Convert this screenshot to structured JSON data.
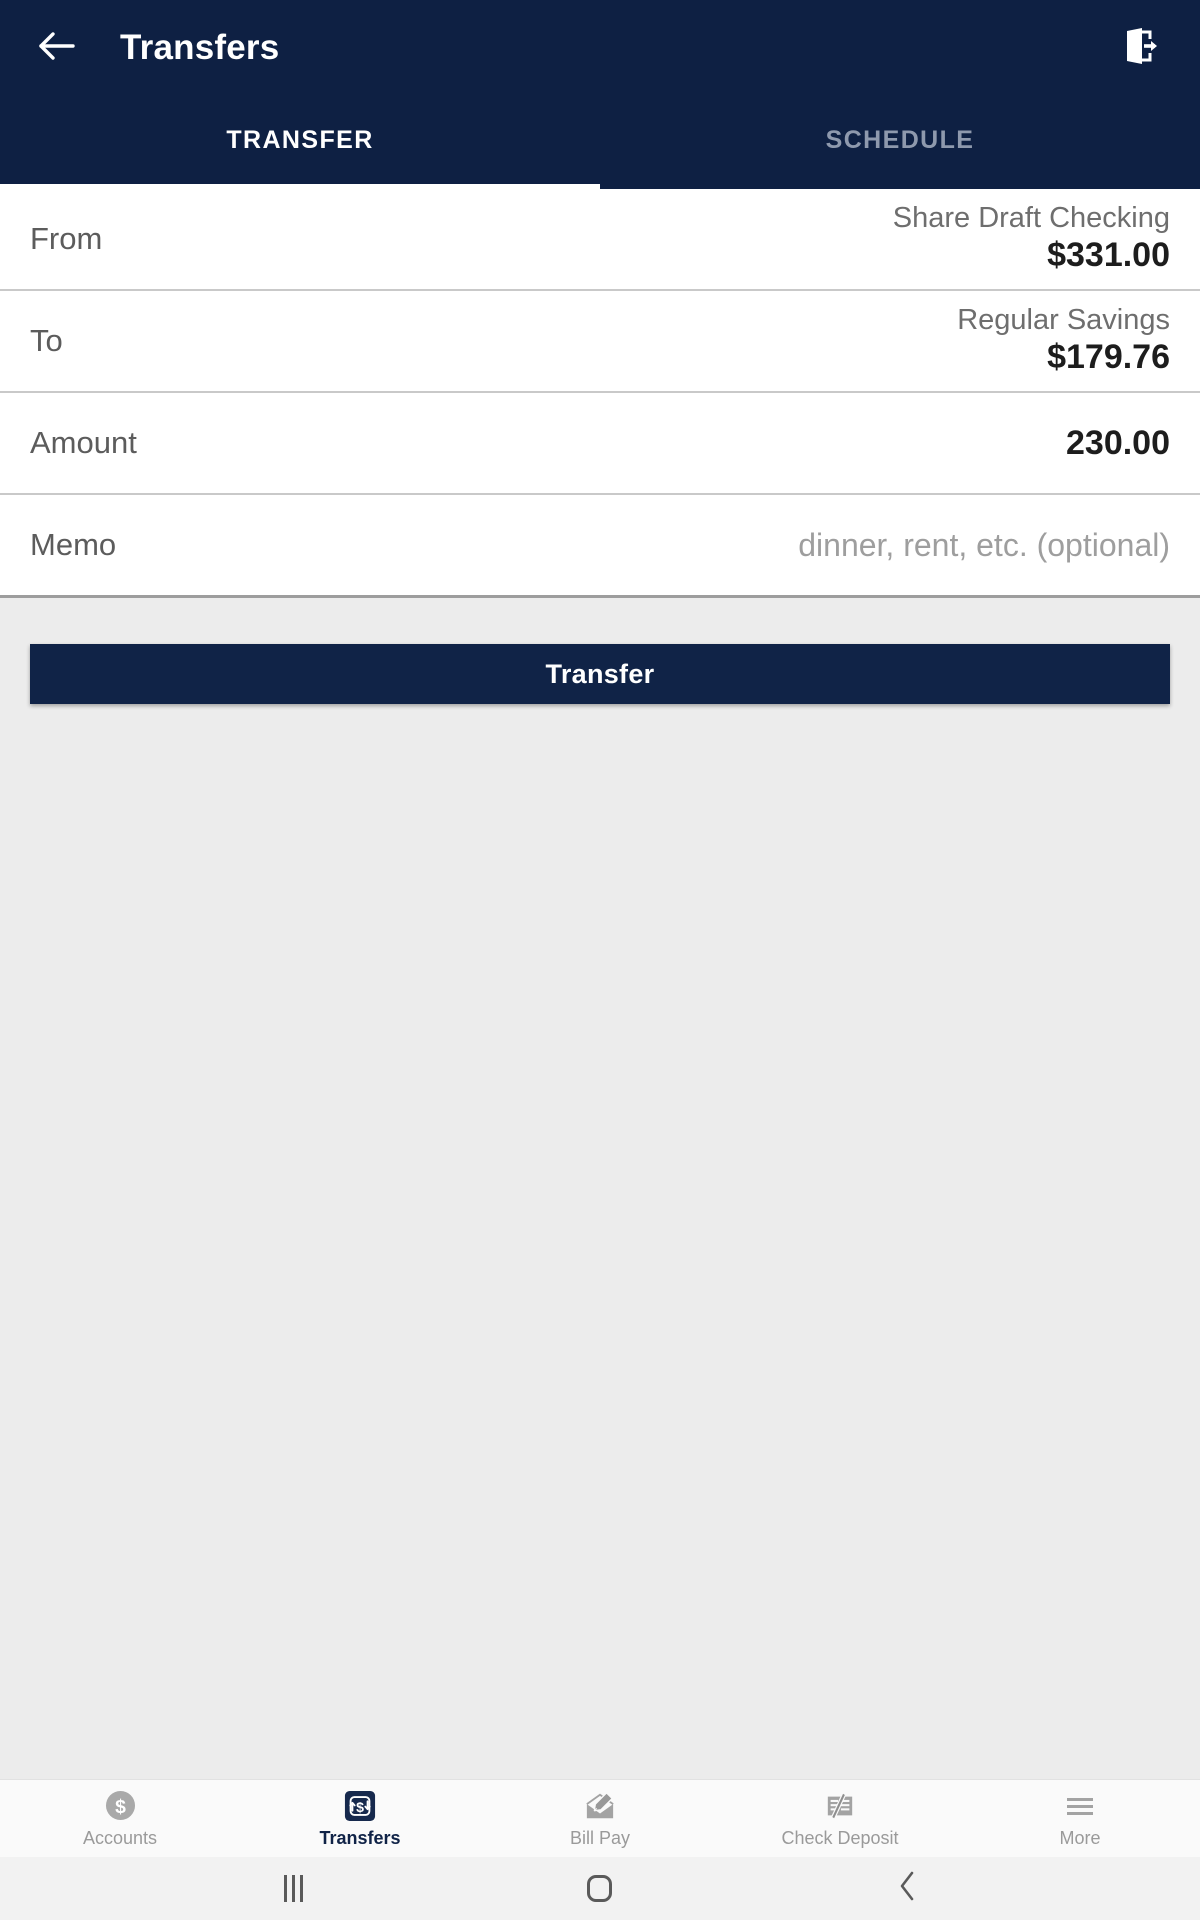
{
  "theme": {
    "brand_navy": "#0e2043",
    "button_navy": "#102347",
    "body_gray": "#ececec",
    "divider_gray": "#c9c9c9",
    "muted_text": "#9a9a9a"
  },
  "appbar": {
    "title": "Transfers",
    "back_icon": "arrow-left-icon",
    "logout_icon": "logout-icon"
  },
  "tabs": [
    {
      "label": "TRANSFER",
      "active": true
    },
    {
      "label": "SCHEDULE",
      "active": false
    }
  ],
  "form": {
    "rows": [
      {
        "label": "From",
        "account_name": "Share Draft Checking",
        "balance": "$331.00"
      },
      {
        "label": "To",
        "account_name": "Regular Savings",
        "balance": "$179.76"
      },
      {
        "label": "Amount",
        "value": "230.00"
      },
      {
        "label": "Memo",
        "placeholder": "dinner, rent, etc. (optional)",
        "value": ""
      }
    ]
  },
  "actions": {
    "transfer_label": "Transfer"
  },
  "bottom_nav": [
    {
      "label": "Accounts",
      "icon": "dollar-circle-icon",
      "active": false
    },
    {
      "label": "Transfers",
      "icon": "transfer-arrows-icon",
      "active": true
    },
    {
      "label": "Bill Pay",
      "icon": "envelope-pen-icon",
      "active": false
    },
    {
      "label": "Check Deposit",
      "icon": "check-pen-icon",
      "active": false
    },
    {
      "label": "More",
      "icon": "hamburger-menu-icon",
      "active": false
    }
  ],
  "system_bar": {
    "recents": "recent-apps-icon",
    "home": "home-icon",
    "back": "back-chevron-icon"
  }
}
